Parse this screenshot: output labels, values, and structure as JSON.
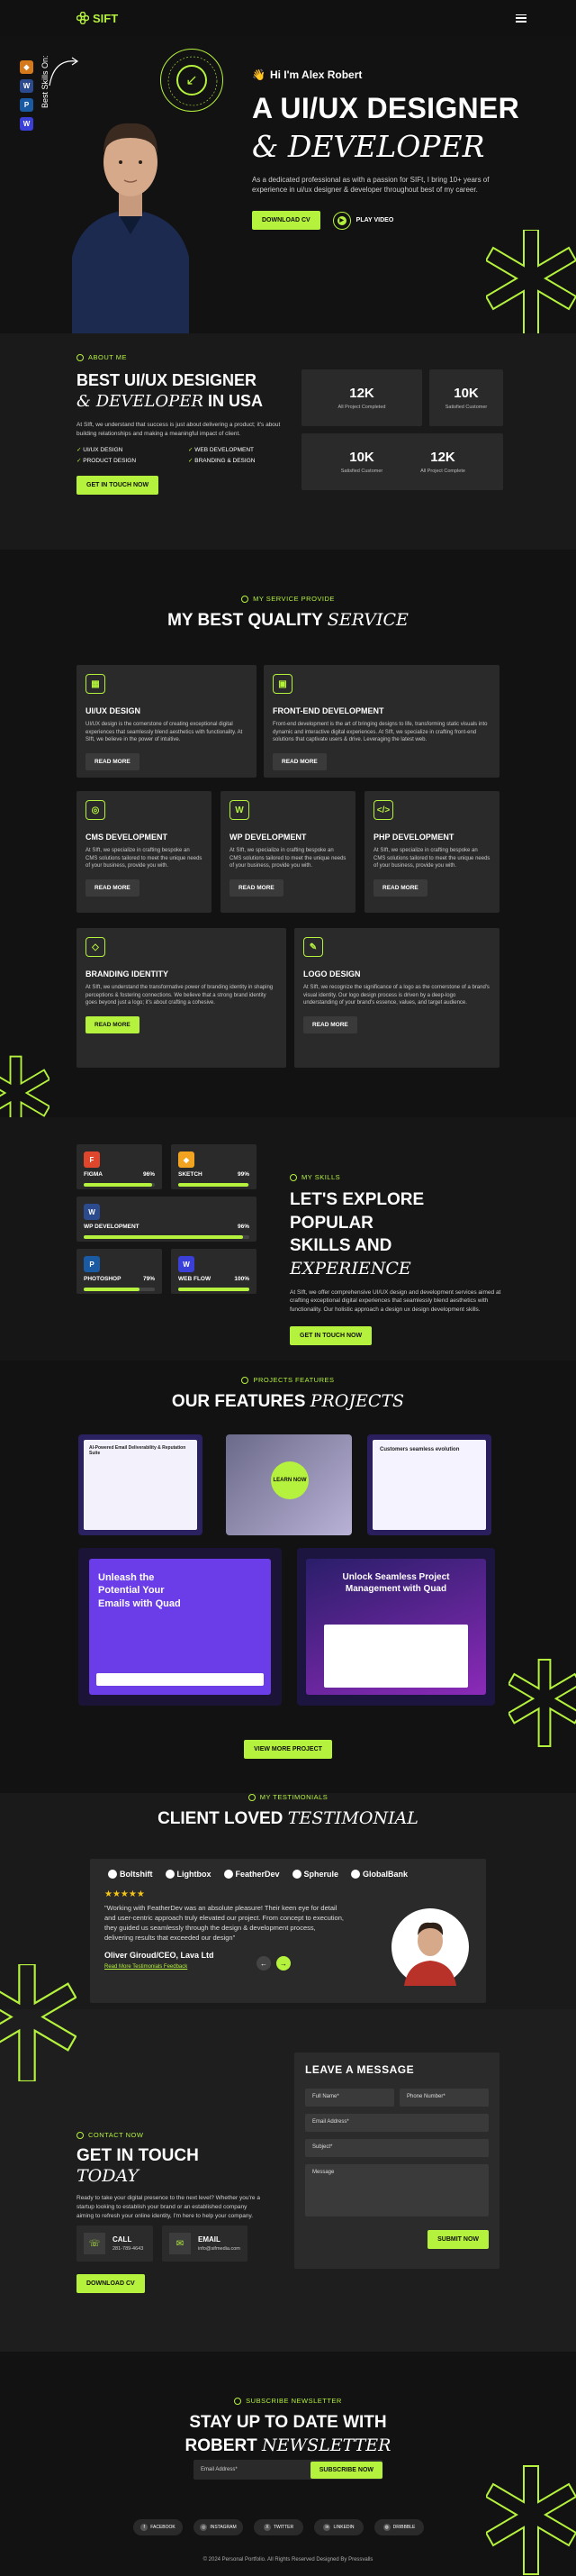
{
  "header": {
    "logo": "SIFT"
  },
  "hero": {
    "skills_on": "Best Skills On:",
    "hello": "Hi I'm Alex Robert",
    "title_line1": "A UI/UX DESIGNER",
    "title_line2": "& DEVELOPER",
    "desc": "As a dedicated professional as with a passion for SIFt, I bring 10+ years of experience in ui/ux designer & developer throughout best of my career.",
    "cta": "DOWNLOAD CV",
    "play": "PLAY VIDEO"
  },
  "about": {
    "eyebrow": "ABOUT ME",
    "title_a": "BEST UI/UX DESIGNER",
    "title_b": "& DEVELOPER",
    "title_c": " IN USA",
    "desc": "At SIft, we understand that success is just about delivering a product; it's about building relationships and making a meaningful impact of client.",
    "checks": [
      "UI/UX DESIGN",
      "WEB DEVELOPMENT",
      "PRODUCT DESIGN",
      "BRANDING & DESIGN"
    ],
    "cta": "GET IN TOUCH NOW",
    "stats": [
      {
        "n": "12K",
        "l": "All Project Completed"
      },
      {
        "n": "10K",
        "l": "Satisfied Customer"
      },
      {
        "n": "10K",
        "l": "Satisfied Customer"
      },
      {
        "n": "12K",
        "l": "All Project Complete"
      }
    ]
  },
  "services": {
    "eyebrow": "MY SERVICE PROVIDE",
    "title_a": "MY BEST QUALITY ",
    "title_b": "SERVICE",
    "cards": [
      {
        "title": "UI/UX DESIGN",
        "desc": "UI/UX design is the cornerstone of creating exceptional digital experiences that seamlessly blend aesthetics with functionality. At SIft, we believe in the power of intuitive.",
        "btn": "READ MORE"
      },
      {
        "title": "FRONT-END DEVELOPMENT",
        "desc": "Front-end development is the art of bringing designs to life, transforming static visuals into dynamic and interactive digital experiences. At SIft, we specialize in crafting front-end solutions that captivate users & drive. Leveraging the latest web.",
        "btn": "READ MORE"
      },
      {
        "title": "CMS DEVELOPMENT",
        "desc": "At SIft, we specialize in crafting bespoke an CMS solutions tailored to meet the unique needs of your business, provide you with.",
        "btn": "READ MORE"
      },
      {
        "title": "WP DEVELOPMENT",
        "desc": "At SIft, we specialize in crafting bespoke an CMS solutions tailored to meet the unique needs of your business, provide you with.",
        "btn": "READ MORE"
      },
      {
        "title": "PHP DEVELOPMENT",
        "desc": "At SIft, we specialize in crafting bespoke an CMS solutions tailored to meet the unique needs of your business, provide you with.",
        "btn": "READ MORE"
      },
      {
        "title": "BRANDING IDENTITY",
        "desc": "At SIft, we understand the transformative power of branding identity in shaping perceptions & fostering connections. We believe that a strong brand identity goes beyond just a logo; it's about crafting a cohesive.",
        "btn": "READ MORE"
      },
      {
        "title": "LOGO DESIGN",
        "desc": "At SIft, we recognize the significance of a logo as the cornerstone of a brand's visual identity. Our logo design process is driven by a deep-logo understanding of your brand's essence, values, and target audience.",
        "btn": "READ MORE"
      }
    ]
  },
  "skills": {
    "eyebrow": "MY SKILLS",
    "title_a": "LET'S EXPLORE POPULAR",
    "title_b": "SKILLS AND ",
    "title_c": "EXPERIENCE",
    "desc": "At SIft, we offer comprehensive UI/UX design and development services aimed at crafting exceptional digital experiences that seamlessly blend aesthetics with functionality. Our holistic approach a design ux design development skills.",
    "cta": "GET IN TOUCH NOW",
    "items": [
      {
        "name": "FIGMA",
        "pct": "96%",
        "value": 96
      },
      {
        "name": "SKETCH",
        "pct": "99%",
        "value": 99
      },
      {
        "name": "WP DEVELOPMENT",
        "pct": "96%",
        "value": 96
      },
      {
        "name": "PHOTOSHOP",
        "pct": "79%",
        "value": 79
      },
      {
        "name": "WEB FLOW",
        "pct": "100%",
        "value": 100
      }
    ]
  },
  "features": {
    "eyebrow": "PROJECTS FEATURES",
    "title_a": "OUR FEATURES ",
    "title_b": "PROJECTS",
    "learn": "LEARN NOW",
    "shot4_title": "Unleash the Potential Your Emails with Quad",
    "shot5_title": "Unlock Seamless Project Management with Quad",
    "shot1_title": "AI-Powered Email Deliverability & Reputation Suite",
    "shot3_title": "Customers seamless evolution",
    "cta": "VIEW MORE PROJECT"
  },
  "testimonials": {
    "eyebrow": "MY TESTIMONIALS",
    "title_a": "CLIENT LOVED ",
    "title_b": "TESTIMONIAL",
    "brands": [
      "Boltshift",
      "Lightbox",
      "FeatherDev",
      "Spherule",
      "GlobalBank"
    ],
    "stars": "★★★★★",
    "quote": "\"Working with FeatherDev was an absolute pleasure! Their keen eye for detail and user-centric approach truly elevated our project. From concept to execution, they guided us seamlessly through the design & development process, delivering results that exceeded our design\"",
    "name": "Oliver Giroud/CEO, Lava Ltd",
    "link": "Read More Testimonials Feedback"
  },
  "contact": {
    "eyebrow": "CONTACT NOW",
    "title_a": "GET IN TOUCH ",
    "title_b": "TODAY",
    "desc": "Ready to take your digital presence to the next level? Whether you're a startup looking to establish your brand or an established company aiming to refresh your online identity, I'm here to help your company.",
    "call_label": "CALL",
    "call_value": "281-789-4643",
    "email_label": "EMAIL",
    "email_value": "info@sifmedia.com",
    "cta": "DOWNLOAD CV",
    "form_title": "LEAVE A MESSAGE",
    "full_name": "Full Name*",
    "phone": "Phone Number*",
    "email": "Email Address*",
    "subject": "Subject*",
    "message": "Message",
    "submit": "SUBMIT NOW"
  },
  "newsletter": {
    "eyebrow": "SUBSCRIBE NEWSLETTER",
    "title_a": "STAY UP TO DATE WITH",
    "title_b": "ROBERT ",
    "title_c": "NEWSLETTER",
    "placeholder": "Email Address*",
    "btn": "SUBSCRIBE NOW",
    "socials": [
      "FACEBOOK",
      "INSTAGRAM",
      "TWITTER",
      "LINKEDIN",
      "DRIBBBLE"
    ],
    "copyright": "© 2024 Personal Portfolio. All Rights Reserved Designed By Pressvalls"
  },
  "colors": {
    "accent": "#b5f23d",
    "bg": "#121212",
    "card": "#2a2a2a"
  }
}
